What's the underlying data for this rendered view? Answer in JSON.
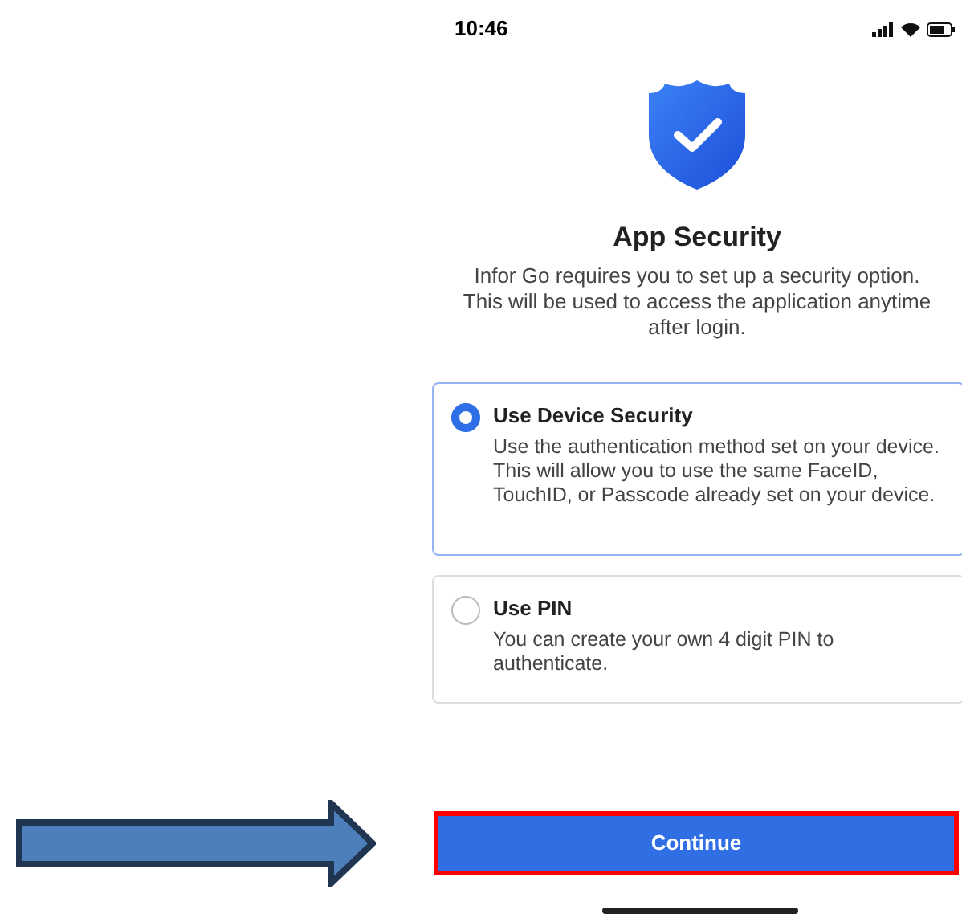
{
  "status_bar": {
    "time": "10:46"
  },
  "title": "App Security",
  "description": "Infor Go requires you to set up a security option. This will be used to access the application anytime after login.",
  "options": [
    {
      "title": "Use Device Security",
      "description": "Use the authentication method set on your device. This will allow you to use the same FaceID, TouchID, or Passcode already set on your device.",
      "selected": true
    },
    {
      "title": "Use PIN",
      "description": "You can create your own 4 digit PIN to authenticate.",
      "selected": false
    }
  ],
  "continue_button": {
    "label": "Continue"
  }
}
